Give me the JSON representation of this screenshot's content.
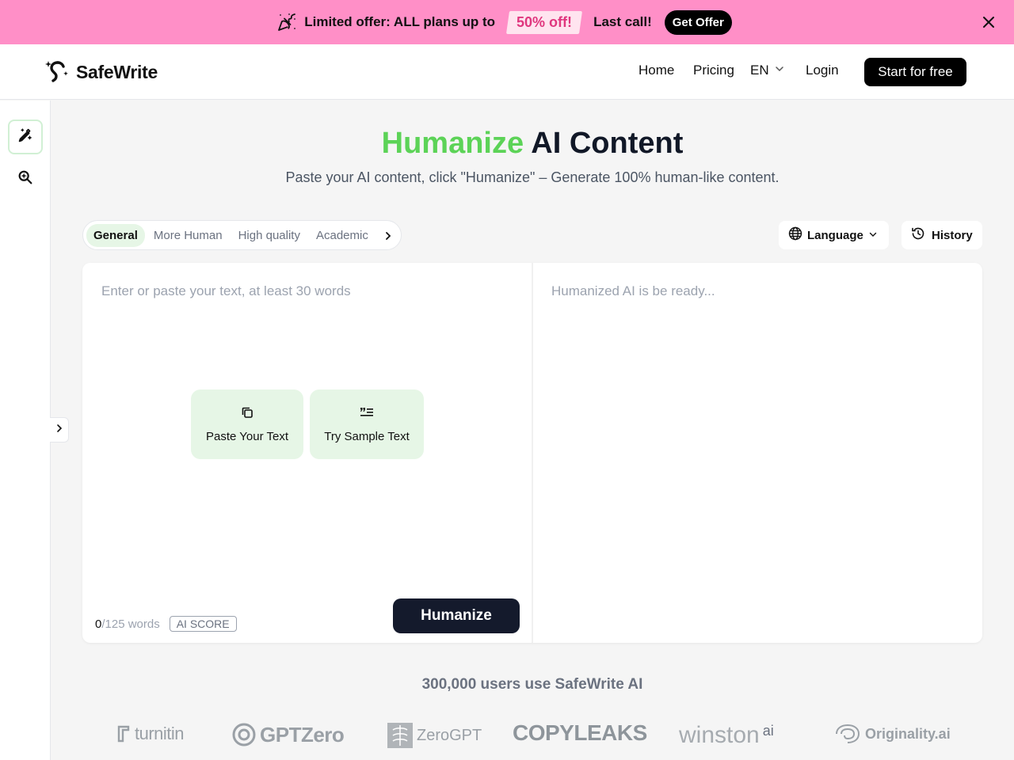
{
  "promo": {
    "text": "Limited offer: ALL plans up to",
    "badge": "50% off!",
    "last_call": "Last call!",
    "button": "Get Offer"
  },
  "header": {
    "logo_text": "SafeWrite",
    "nav": {
      "home": "Home",
      "pricing": "Pricing",
      "language": "EN",
      "login": "Login"
    },
    "cta": "Start for free"
  },
  "hero": {
    "title_accent": "Humanize",
    "title_rest": " AI Content",
    "subtitle": "Paste your AI content, click \"Humanize\" – Generate 100% human-like content."
  },
  "toolbar": {
    "modes": [
      "General",
      "More Human",
      "High quality",
      "Academic"
    ],
    "active_mode": "General",
    "language_label": "Language",
    "history_label": "History"
  },
  "editor": {
    "input_placeholder": "Enter or paste your text, at least 30 words",
    "paste_label": "Paste Your Text",
    "sample_label": "Try Sample Text",
    "word_count": "0",
    "word_limit": "/125 words",
    "ai_score": "AI SCORE",
    "humanize": "Humanize",
    "output_placeholder": "Humanized AI is be ready..."
  },
  "social_proof": {
    "users": "300,000 users use SafeWrite AI",
    "brands": [
      "turnitin",
      "GPTZero",
      "ZeroGPT",
      "COPYLEAKS",
      "winston",
      "ai",
      "Originality.ai"
    ]
  },
  "colors": {
    "accent_green": "#5cd357",
    "promo_pink": "#ff8fc7",
    "dark_button": "#141a2c"
  }
}
